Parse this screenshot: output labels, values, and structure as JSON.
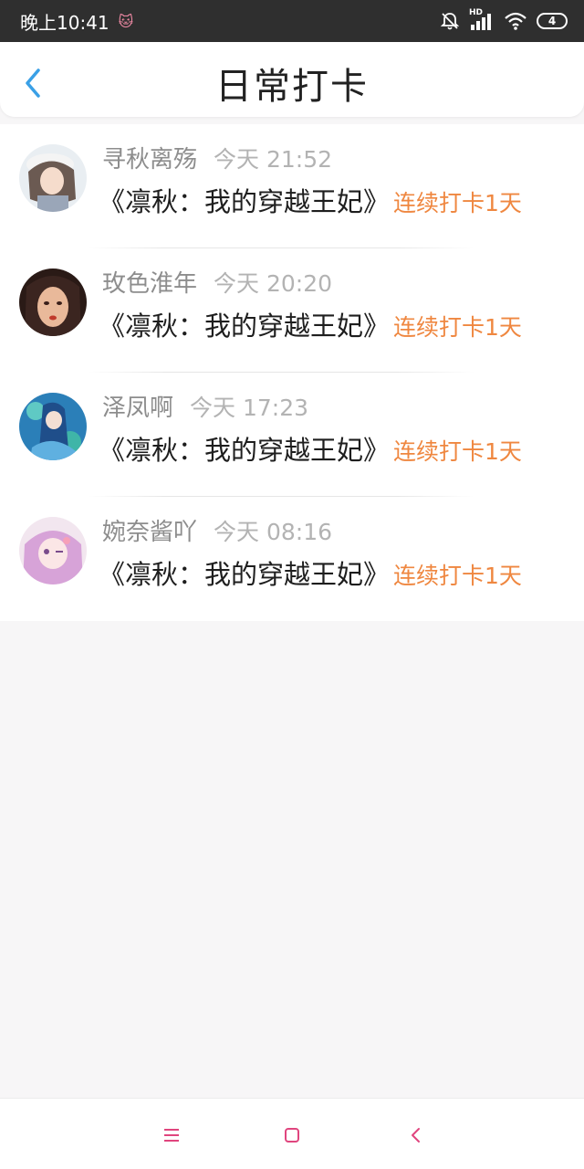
{
  "status_bar": {
    "time": "晚上10:41",
    "hd_label": "HD",
    "battery": "4"
  },
  "header": {
    "title": "日常打卡",
    "back_icon": "chevron-left-icon"
  },
  "checkins": [
    {
      "username": "寻秋离殇",
      "time": "今天 21:52",
      "book": "《凛秋：我的穿越王妃》",
      "streak": "连续打卡1天"
    },
    {
      "username": "玫色淮年",
      "time": "今天 20:20",
      "book": "《凛秋：我的穿越王妃》",
      "streak": "连续打卡1天"
    },
    {
      "username": "泽凤啊",
      "time": "今天 17:23",
      "book": "《凛秋：我的穿越王妃》",
      "streak": "连续打卡1天"
    },
    {
      "username": "婉奈酱吖",
      "time": "今天 08:16",
      "book": "《凛秋：我的穿越王妃》",
      "streak": "连续打卡1天"
    }
  ],
  "colors": {
    "accent_orange": "#ef8740",
    "back_blue": "#3aa0e6",
    "nav_pink": "#e0457e"
  },
  "navbar": {
    "icons": [
      "menu-icon",
      "home-square-icon",
      "back-triangle-icon"
    ]
  }
}
